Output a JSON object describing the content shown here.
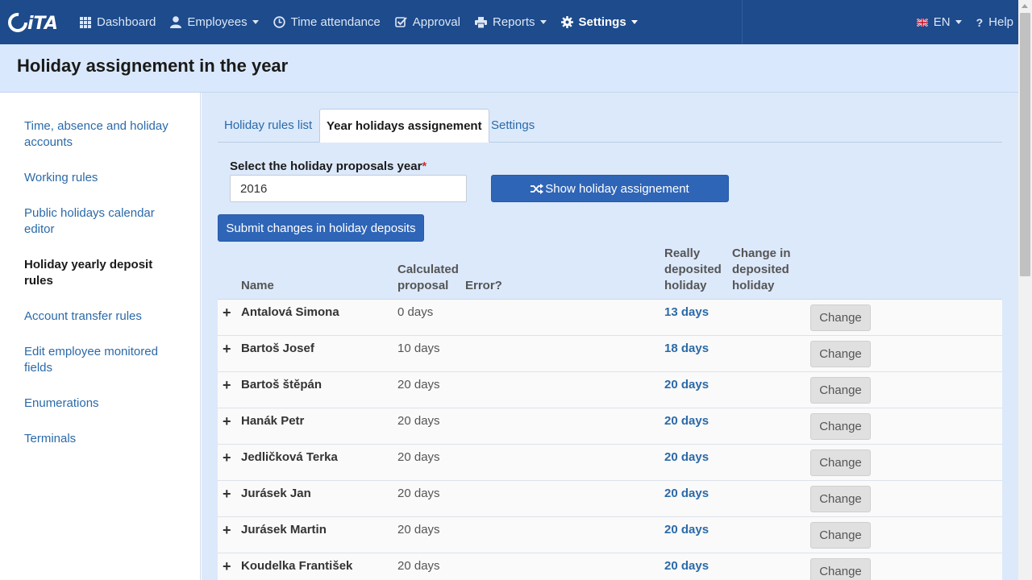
{
  "navbar": {
    "logo": "iTA",
    "items": [
      {
        "label": "Dashboard",
        "icon": "grid-icon",
        "dropdown": false
      },
      {
        "label": "Employees",
        "icon": "user-icon",
        "dropdown": true
      },
      {
        "label": "Time attendance",
        "icon": "clock-icon",
        "dropdown": false
      },
      {
        "label": "Approval",
        "icon": "check-square-icon",
        "dropdown": false
      },
      {
        "label": "Reports",
        "icon": "printer-icon",
        "dropdown": true
      },
      {
        "label": "Settings",
        "icon": "gear-icon",
        "dropdown": true,
        "active": true
      }
    ],
    "language": "EN",
    "help": "Help"
  },
  "page": {
    "title": "Holiday assignement in the year"
  },
  "sidebar": {
    "items": [
      {
        "label": "Time, absence and holiday accounts"
      },
      {
        "label": "Working rules"
      },
      {
        "label": "Public holidays calendar editor"
      },
      {
        "label": "Holiday yearly deposit rules",
        "active": true
      },
      {
        "label": "Account transfer rules"
      },
      {
        "label": "Edit employee monitored fields"
      },
      {
        "label": "Enumerations"
      },
      {
        "label": "Terminals"
      }
    ]
  },
  "tabs": [
    {
      "label": "Holiday rules list"
    },
    {
      "label": "Year holidays assignement",
      "active": true
    },
    {
      "label": "Settings"
    }
  ],
  "form": {
    "year_label": "Select the holiday proposals year",
    "required_mark": "*",
    "year_value": "2016",
    "show_button": "Show holiday assignement",
    "submit_button": "Submit changes in holiday deposits"
  },
  "table": {
    "headers": {
      "name": "Name",
      "calculated_line1": "Calculated",
      "calculated_line2": "proposal",
      "error": "Error?",
      "really_line1": "Really",
      "really_line2": "deposited",
      "really_line3": "holiday",
      "change_line1": "Change in",
      "change_line2": "deposited",
      "change_line3": "holiday"
    },
    "change_label": "Change",
    "rows": [
      {
        "name": "Antalová Simona",
        "calculated": "0 days",
        "deposited": "13 days"
      },
      {
        "name": "Bartoš Josef",
        "calculated": "10 days",
        "deposited": "18 days"
      },
      {
        "name": "Bartoš štěpán",
        "calculated": "20 days",
        "deposited": "20 days"
      },
      {
        "name": "Hanák Petr",
        "calculated": "20 days",
        "deposited": "20 days"
      },
      {
        "name": "Jedličková Terka",
        "calculated": "20 days",
        "deposited": "20 days"
      },
      {
        "name": "Jurásek Jan",
        "calculated": "20 days",
        "deposited": "20 days"
      },
      {
        "name": "Jurásek Martin",
        "calculated": "20 days",
        "deposited": "20 days"
      },
      {
        "name": "Koudelka František",
        "calculated": "20 days",
        "deposited": "20 days"
      }
    ]
  },
  "colors": {
    "navbar": "#1d4b8c",
    "header_band": "#d9e8fc",
    "link": "#2b6aa8",
    "primary_button": "#2f65b7"
  }
}
